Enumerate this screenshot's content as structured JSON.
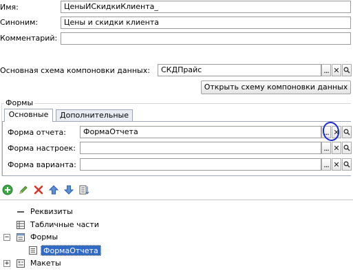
{
  "fields": {
    "name": {
      "label": "Имя:",
      "value": "ЦеныИСкидкиКлиента_"
    },
    "synonym": {
      "label": "Синоним:",
      "value": "Цены и скидки клиента"
    },
    "comment": {
      "label": "Комментарий:",
      "value": ""
    },
    "schema": {
      "label": "Основная схема компоновки данных:",
      "value": "СКДПрайс"
    }
  },
  "open_schema_button": "Открыть схему компоновки данных",
  "forms_group": {
    "title": "Формы",
    "tabs": [
      "Основные",
      "Дополнительные"
    ],
    "active_tab": 0,
    "rows": [
      {
        "label": "Форма отчета:",
        "value": "ФормаОтчета"
      },
      {
        "label": "Форма настроек:",
        "value": ""
      },
      {
        "label": "Форма варианта:",
        "value": ""
      }
    ]
  },
  "toolbar": [
    "add-icon",
    "edit-icon",
    "delete-icon",
    "move-up-icon",
    "move-down-icon",
    "sort-list-icon"
  ],
  "tree": [
    {
      "label": "Реквизиты",
      "icon": "attributes-icon",
      "expander": ""
    },
    {
      "label": "Табличные части",
      "icon": "tabular-sections-icon",
      "expander": ""
    },
    {
      "label": "Формы",
      "icon": "forms-icon",
      "expander": "−"
    },
    {
      "label": "ФормаОтчета",
      "icon": "form-icon",
      "expander": "",
      "selected": true
    },
    {
      "label": "Макеты",
      "icon": "templates-icon",
      "expander": "+"
    }
  ],
  "colors": {
    "selection": "#3169c6",
    "annotation": "#1a2bd8",
    "tab_active": "#ffffff",
    "tab_inactive": "#e9edf3"
  }
}
